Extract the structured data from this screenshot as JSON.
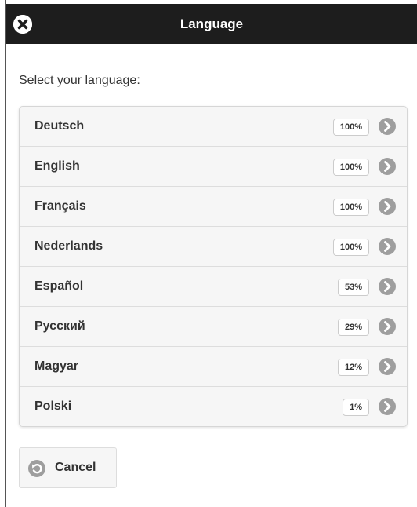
{
  "header": {
    "title": "Language",
    "close_icon": "close-icon"
  },
  "prompt": "Select your language:",
  "languages": [
    {
      "label": "Deutsch",
      "badge": "100%"
    },
    {
      "label": "English",
      "badge": "100%"
    },
    {
      "label": "Français",
      "badge": "100%"
    },
    {
      "label": "Nederlands",
      "badge": "100%"
    },
    {
      "label": "Español",
      "badge": "53%"
    },
    {
      "label": "Русский",
      "badge": "29%"
    },
    {
      "label": "Magyar",
      "badge": "12%"
    },
    {
      "label": "Polski",
      "badge": "1%"
    }
  ],
  "cancel": {
    "label": "Cancel",
    "icon": "back-arrow-icon"
  },
  "colors": {
    "header_bg": "#1d1d1d",
    "row_bg": "#f6f6f6",
    "icon_grey": "#9e9e9e"
  }
}
